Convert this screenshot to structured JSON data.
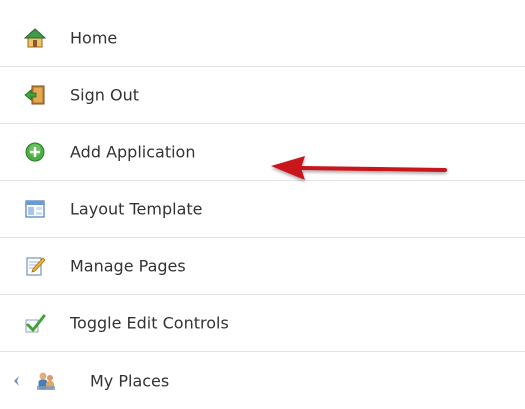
{
  "menu": {
    "items": [
      {
        "label": "Home",
        "icon": "home-icon"
      },
      {
        "label": "Sign Out",
        "icon": "sign-out-icon"
      },
      {
        "label": "Add Application",
        "icon": "add-icon"
      },
      {
        "label": "Layout Template",
        "icon": "layout-icon"
      },
      {
        "label": "Manage Pages",
        "icon": "edit-pages-icon"
      },
      {
        "label": "Toggle Edit Controls",
        "icon": "checkmark-icon"
      },
      {
        "label": "My Places",
        "icon": "places-icon"
      }
    ]
  },
  "annotation": {
    "arrow_color": "#c8141b",
    "target": "Add Application"
  },
  "colors": {
    "text": "#333333",
    "divider": "#e2e2e2",
    "add_green": "#3fa33a",
    "check_green": "#3ea43a",
    "chevron_blue": "#6a8fc4"
  }
}
